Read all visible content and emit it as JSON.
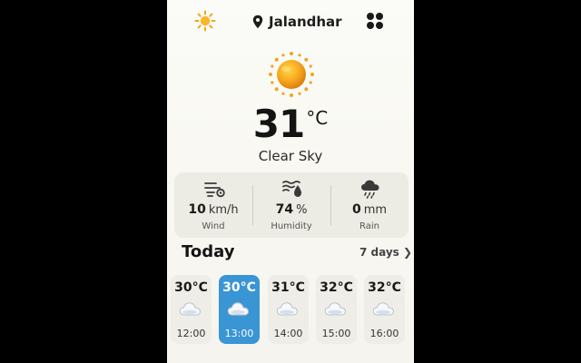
{
  "header": {
    "theme_icon": "sun-icon",
    "location_icon": "location-pin-icon",
    "location": "Jalandhar",
    "menu_icon": "grid-menu-icon"
  },
  "current": {
    "icon": "sun-icon",
    "temperature": "31",
    "unit": "°C",
    "condition": "Clear Sky"
  },
  "stats": [
    {
      "icon": "wind-icon",
      "value": "10",
      "unit": "km/h",
      "label": "Wind"
    },
    {
      "icon": "humidity-icon",
      "value": "74",
      "unit": "%",
      "label": "Humidity"
    },
    {
      "icon": "rain-cloud-icon",
      "value": "0",
      "unit": "mm",
      "label": "Rain"
    }
  ],
  "hourly": {
    "title": "Today",
    "link": "7 days ❯",
    "items": [
      {
        "temp": "30°C",
        "time": "12:00",
        "icon": "cloud-icon"
      },
      {
        "temp": "30°C",
        "time": "13:00",
        "icon": "cloud-icon",
        "selected": true
      },
      {
        "temp": "31°C",
        "time": "14:00",
        "icon": "cloud-icon"
      },
      {
        "temp": "32°C",
        "time": "15:00",
        "icon": "cloud-icon"
      },
      {
        "temp": "32°C",
        "time": "16:00",
        "icon": "cloud-icon"
      }
    ]
  },
  "colors": {
    "accent": "#3a95d5",
    "sun": "#f5a623",
    "card": "#eeede7",
    "background": "#f8f7f1"
  }
}
